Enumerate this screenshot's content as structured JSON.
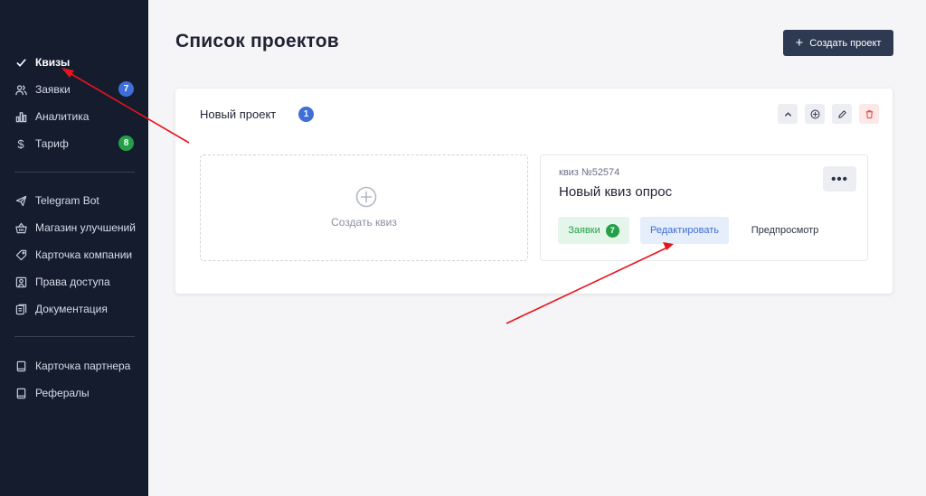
{
  "sidebar": {
    "items": [
      {
        "label": "Квизы",
        "icon": "check-icon",
        "active": true
      },
      {
        "label": "Заявки",
        "icon": "users-icon",
        "badge": "7",
        "badge_color": "#3f6ed6"
      },
      {
        "label": "Аналитика",
        "icon": "bar-chart-icon"
      },
      {
        "label": "Тариф",
        "icon": "dollar-icon",
        "badge": "8",
        "badge_color": "#24a148"
      },
      {
        "label": "Telegram Bot",
        "icon": "send-icon"
      },
      {
        "label": "Магазин улучшений",
        "icon": "basket-icon"
      },
      {
        "label": "Карточка компании",
        "icon": "tag-icon"
      },
      {
        "label": "Права доступа",
        "icon": "user-square-icon"
      },
      {
        "label": "Документация",
        "icon": "document-icon"
      },
      {
        "label": "Карточка партнера",
        "icon": "book-icon"
      },
      {
        "label": "Рефералы",
        "icon": "book-icon"
      }
    ]
  },
  "header": {
    "title": "Список проектов",
    "create_button": "Создать проект"
  },
  "project": {
    "name": "Новый проект",
    "count": "1",
    "create_quiz": "Создать квиз",
    "quiz": {
      "number": "квиз №52574",
      "title": "Новый квиз опрос",
      "requests_label": "Заявки",
      "requests_count": "7",
      "edit_label": "Редактировать",
      "preview_label": "Предпросмотр"
    }
  },
  "colors": {
    "sidebar_bg": "#141c2e",
    "accent_blue": "#3f6ed6",
    "accent_green": "#24a148",
    "danger": "#e5484d",
    "annotation_arrow": "#e8141c"
  }
}
